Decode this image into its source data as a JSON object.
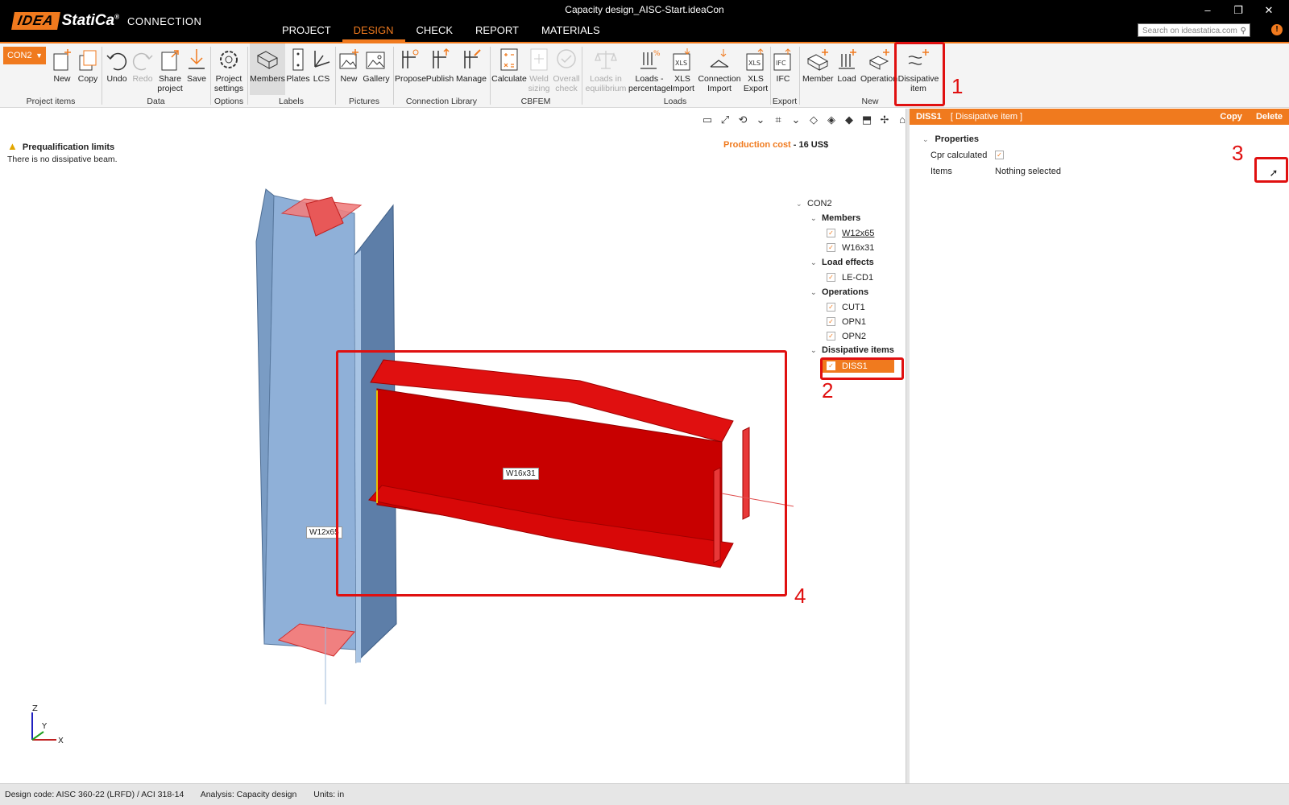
{
  "app": {
    "logo_brand": "IDEA StatiCa",
    "logo_product": "CONNECTION",
    "document_title": "Capacity design_AISC-Start.ideaCon",
    "window_controls": [
      "–",
      "❐",
      "✕"
    ]
  },
  "main_tabs": [
    {
      "label": "PROJECT",
      "active": false
    },
    {
      "label": "DESIGN",
      "active": true
    },
    {
      "label": "CHECK",
      "active": false
    },
    {
      "label": "REPORT",
      "active": false
    },
    {
      "label": "MATERIALS",
      "active": false
    }
  ],
  "search": {
    "placeholder": "Search on ideastatica.com"
  },
  "connection_selector": {
    "value": "CON2"
  },
  "ribbon": {
    "buttons": {
      "new": "New",
      "copy": "Copy",
      "undo": "Undo",
      "redo": "Redo",
      "share_project": "Share project",
      "save": "Save",
      "project_settings": "Project settings",
      "members": "Members",
      "plates": "Plates",
      "lcs": "LCS",
      "pic_new": "New",
      "gallery": "Gallery",
      "propose": "Propose",
      "publish": "Publish",
      "manage": "Manage",
      "calculate": "Calculate",
      "weld_sizing": "Weld sizing",
      "overall_check": "Overall check",
      "loads_in_equilibrium": "Loads in equilibrium",
      "loads_percentage": "Loads - percentage",
      "xls_import": "XLS Import",
      "connection_import": "Connection Import",
      "xls_export": "XLS Export",
      "ifc": "IFC",
      "member": "Member",
      "load": "Load",
      "operation": "Operation",
      "dissipative_item": "Dissipative item"
    },
    "groups": {
      "project_items": "Project items",
      "data": "Data",
      "options": "Options",
      "labels": "Labels",
      "pictures": "Pictures",
      "connection_library": "Connection Library",
      "cbfem": "CBFEM",
      "loads": "Loads",
      "export": "Export",
      "new": "New"
    }
  },
  "viewport": {
    "warning_title": "Prequalification limits",
    "warning_text": "There is no dissipative beam.",
    "production_cost_label": "Production cost",
    "production_cost_value": "- 16 US$",
    "member_labels": {
      "column": "W12x65",
      "beam": "W16x31"
    },
    "axis_labels": {
      "z": "Z",
      "y": "Y",
      "x": "X"
    }
  },
  "tree": {
    "root": "CON2",
    "members_label": "Members",
    "members": [
      "W12x65",
      "W16x31"
    ],
    "load_effects_label": "Load effects",
    "load_effects": [
      "LE-CD1"
    ],
    "operations_label": "Operations",
    "operations": [
      "CUT1",
      "OPN1",
      "OPN2"
    ],
    "dissipative_label": "Dissipative items",
    "dissipative": [
      "DISS1"
    ]
  },
  "panel": {
    "item_id": "DISS1",
    "item_type": "[ Dissipative item ]",
    "copy_label": "Copy",
    "delete_label": "Delete",
    "section_label": "Properties",
    "cpr_label": "Cpr calculated",
    "cpr_checked": true,
    "items_label": "Items",
    "items_value": "Nothing selected"
  },
  "annotations": [
    "1",
    "2",
    "3",
    "4"
  ],
  "statusbar": {
    "design_code": "Design code: AISC 360-22 (LRFD) / ACI 318-14",
    "analysis": "Analysis: Capacity design",
    "units": "Units: in"
  },
  "colors": {
    "accent": "#f07a1e",
    "annotation": "#e01010",
    "dissipative_member": "#d40000",
    "column_member": "#7a9cc4"
  }
}
